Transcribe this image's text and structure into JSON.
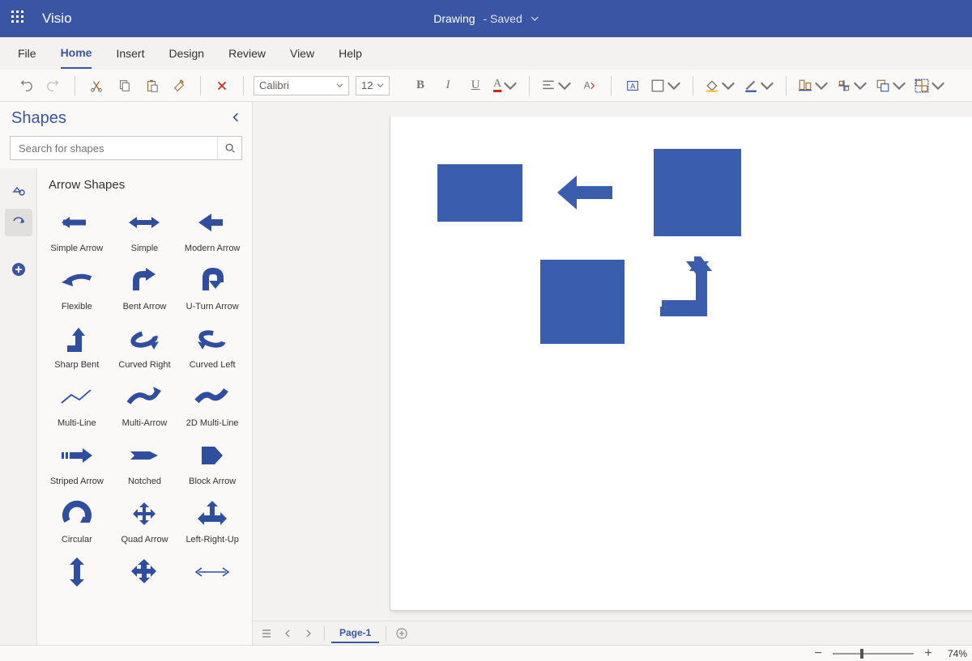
{
  "app": {
    "name": "Visio",
    "doc_name": "Drawing",
    "doc_status": "Saved"
  },
  "menu": {
    "file": "File",
    "home": "Home",
    "insert": "Insert",
    "design": "Design",
    "review": "Review",
    "view": "View",
    "help": "Help"
  },
  "ribbon": {
    "font_name": "Calibri",
    "font_size": "12"
  },
  "shapes": {
    "panel_title": "Shapes",
    "search_placeholder": "Search for shapes",
    "category_title": "Arrow Shapes",
    "items": [
      {
        "label": "Simple Arrow"
      },
      {
        "label": "Simple"
      },
      {
        "label": "Modern Arrow"
      },
      {
        "label": "Flexible"
      },
      {
        "label": "Bent Arrow"
      },
      {
        "label": "U-Turn Arrow"
      },
      {
        "label": "Sharp Bent"
      },
      {
        "label": "Curved Right"
      },
      {
        "label": "Curved Left"
      },
      {
        "label": "Multi-Line"
      },
      {
        "label": "Multi-Arrow"
      },
      {
        "label": "2D Multi-Line"
      },
      {
        "label": "Striped Arrow"
      },
      {
        "label": "Notched"
      },
      {
        "label": "Block Arrow"
      },
      {
        "label": "Circular"
      },
      {
        "label": "Quad Arrow"
      },
      {
        "label": "Left-Right-Up"
      },
      {
        "label": ""
      },
      {
        "label": ""
      },
      {
        "label": ""
      }
    ]
  },
  "pages": {
    "current": "Page-1"
  },
  "status": {
    "zoom_percent": "74%"
  },
  "colors": {
    "brand": "#3955a3",
    "shape": "#3a5dae"
  }
}
